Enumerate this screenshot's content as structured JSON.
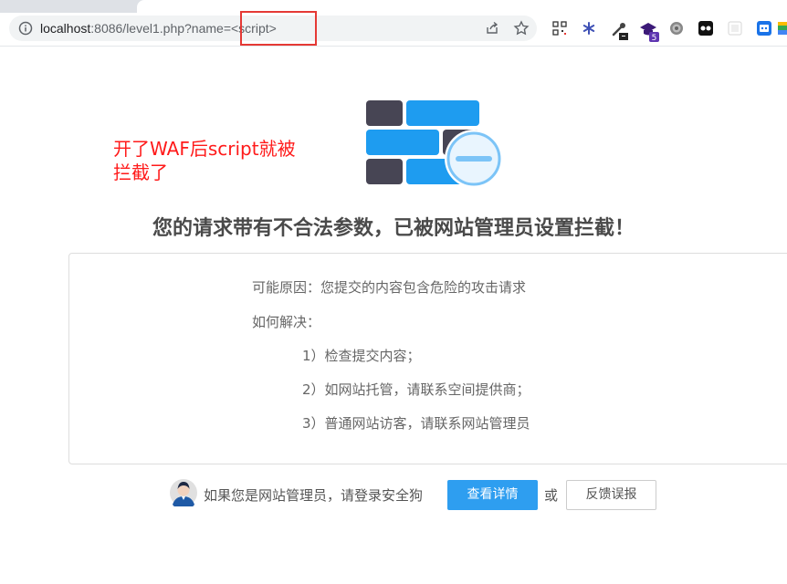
{
  "browser": {
    "url_host": "localhost",
    "url_rest": ":8086/level1.php?name=<script>",
    "extension_badge_count": "5",
    "icons": [
      "info-icon",
      "share-icon",
      "star-icon",
      "qr-code-icon",
      "asterisk-extension-icon",
      "eyedropper-extension-icon",
      "graduation-cap-extension-icon",
      "gear-extension-icon",
      "game-extension-icon",
      "white-extension-icon",
      "chrome-extension-icon",
      "robot-extension-icon",
      "partial-extension-icon"
    ]
  },
  "annotation": {
    "line1": "开了WAF后script就被",
    "line2": "拦截了",
    "color": "#ff1a1a"
  },
  "page": {
    "title": "您的请求带有不合法参数，已被网站管理员设置拦截！",
    "reason": "可能原因：您提交的内容包含危险的攻击请求",
    "how_to_solve": "如何解决：",
    "solutions": [
      "1）检查提交内容；",
      "2）如网站托管，请联系空间提供商；",
      "3）普通网站访客，请联系网站管理员"
    ]
  },
  "footer": {
    "admin_text": "如果您是网站管理员，请登录安全狗",
    "details_button": "查看详情",
    "or_text": "或",
    "feedback_button": "反馈误报"
  },
  "colors": {
    "brand_blue": "#2e9ef0",
    "logo_dark": "#474554",
    "logo_blue": "#1e9cf0",
    "annotation_red": "#ff1a1a"
  }
}
